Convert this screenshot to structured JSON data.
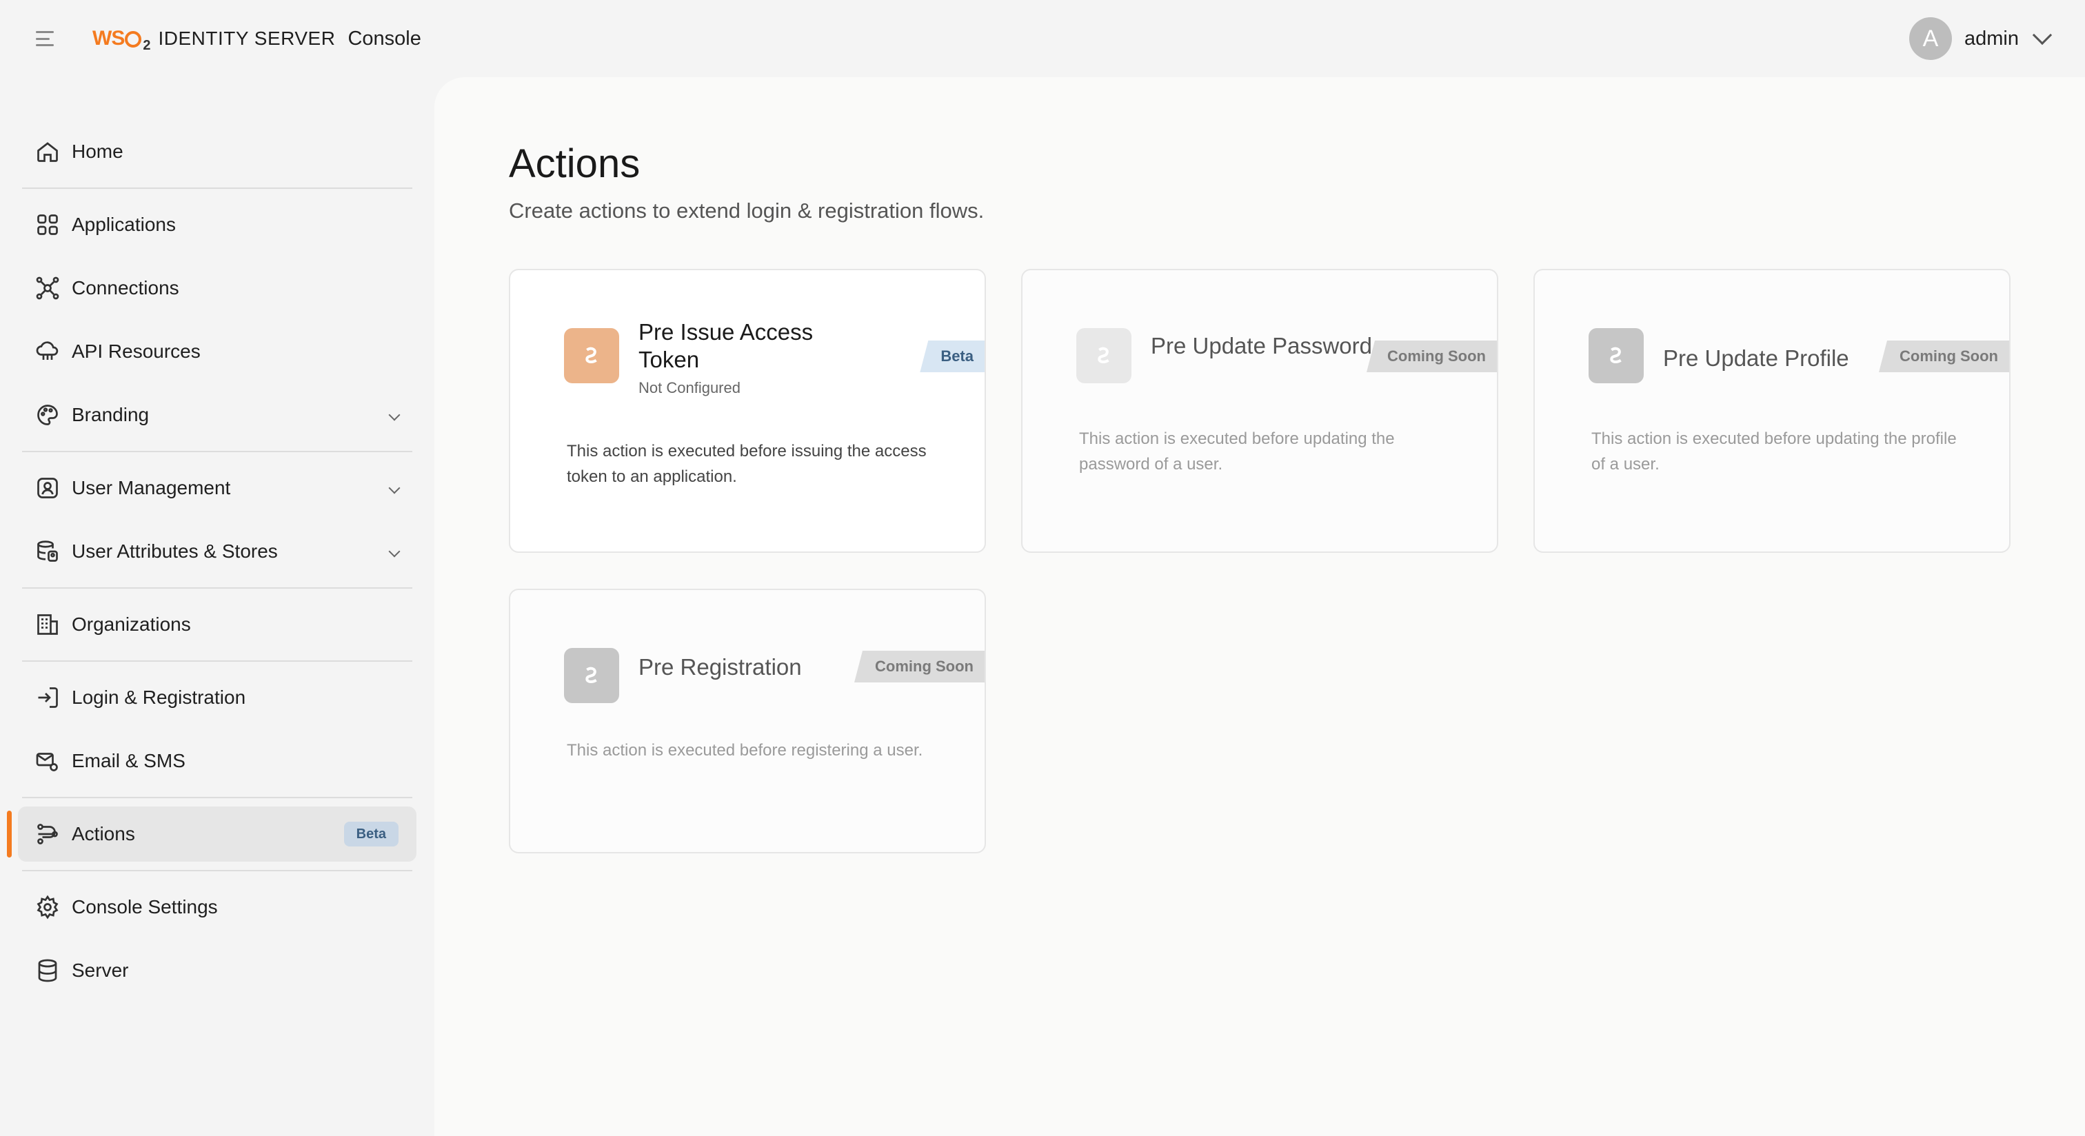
{
  "header": {
    "brand_logo": "WSO",
    "brand_logo_sub": "2",
    "brand_product": "IDENTITY SERVER",
    "brand_console": "Console",
    "user_initial": "A",
    "user_name": "admin"
  },
  "sidebar": {
    "items": [
      {
        "label": "Home",
        "icon": "home-icon"
      },
      {
        "label": "Applications",
        "icon": "grid-icon"
      },
      {
        "label": "Connections",
        "icon": "connections-icon"
      },
      {
        "label": "API Resources",
        "icon": "cloud-icon"
      },
      {
        "label": "Branding",
        "icon": "palette-icon"
      },
      {
        "label": "User Management",
        "icon": "user-badge-icon"
      },
      {
        "label": "User Attributes & Stores",
        "icon": "database-user-icon"
      },
      {
        "label": "Organizations",
        "icon": "building-icon"
      },
      {
        "label": "Login & Registration",
        "icon": "login-icon"
      },
      {
        "label": "Email & SMS",
        "icon": "email-settings-icon"
      },
      {
        "label": "Actions",
        "icon": "actions-icon",
        "badge": "Beta"
      },
      {
        "label": "Console Settings",
        "icon": "gear-icon"
      },
      {
        "label": "Server",
        "icon": "database-icon"
      }
    ]
  },
  "main": {
    "title": "Actions",
    "subtitle": "Create actions to extend login & registration flows."
  },
  "cards": [
    {
      "title": "Pre Issue Access Token",
      "status": "Not Configured",
      "badge": "Beta",
      "description": "This action is executed before issuing the access token to an application."
    },
    {
      "title": "Pre Update Password",
      "badge": "Coming Soon",
      "description": "This action is executed before updating the password of a user."
    },
    {
      "title": "Pre Update Profile",
      "badge": "Coming Soon",
      "description": "This action is executed before updating the profile of a user."
    },
    {
      "title": "Pre Registration",
      "badge": "Coming Soon",
      "description": "This action is executed before registering a user."
    }
  ],
  "colors": {
    "accent": "#f47b20",
    "beta_badge_bg": "#d8e6f3",
    "beta_badge_text": "#3b5f82",
    "soon_badge_bg": "#dcdcdc"
  }
}
